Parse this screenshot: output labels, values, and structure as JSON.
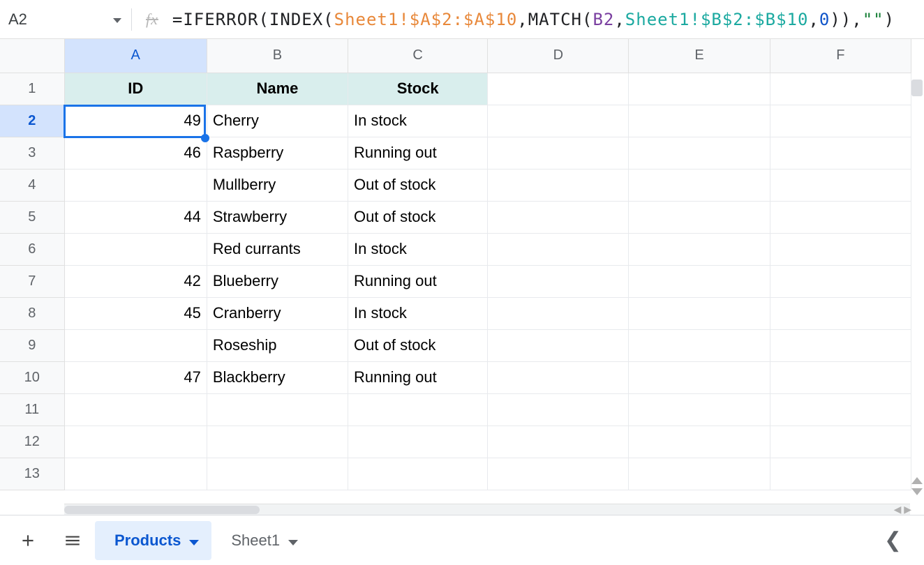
{
  "cell_reference": "A2",
  "formula_parts": {
    "pre": "=IFERROR(INDEX(",
    "range_a": "Sheet1!$A$2:$A$10",
    "mid1": ",MATCH(",
    "cell_b2": "B2",
    "comma1": ",",
    "range_b": "Sheet1!$B$2:$B$10",
    "comma2": ",",
    "zero": "0",
    "close_match_idx": ")),",
    "empty_str": "\"\"",
    "close_all": ")"
  },
  "columns": [
    "A",
    "B",
    "C",
    "D",
    "E",
    "F"
  ],
  "selected_column": "A",
  "selected_row": 2,
  "row_numbers": [
    1,
    2,
    3,
    4,
    5,
    6,
    7,
    8,
    9,
    10,
    11,
    12,
    13
  ],
  "headers": {
    "a": "ID",
    "b": "Name",
    "c": "Stock"
  },
  "rows": [
    {
      "id": "49",
      "name": "Cherry",
      "stock": "In stock"
    },
    {
      "id": "46",
      "name": "Raspberry",
      "stock": "Running out"
    },
    {
      "id": "",
      "name": "Mullberry",
      "stock": "Out of stock"
    },
    {
      "id": "44",
      "name": "Strawberry",
      "stock": "Out of stock"
    },
    {
      "id": "",
      "name": "Red currants",
      "stock": "In stock"
    },
    {
      "id": "42",
      "name": "Blueberry",
      "stock": "Running out"
    },
    {
      "id": "45",
      "name": "Cranberry",
      "stock": "In stock"
    },
    {
      "id": "",
      "name": "Roseship",
      "stock": "Out of stock"
    },
    {
      "id": "47",
      "name": "Blackberry",
      "stock": "Running out"
    }
  ],
  "tabs": {
    "active": "Products",
    "other": "Sheet1"
  }
}
